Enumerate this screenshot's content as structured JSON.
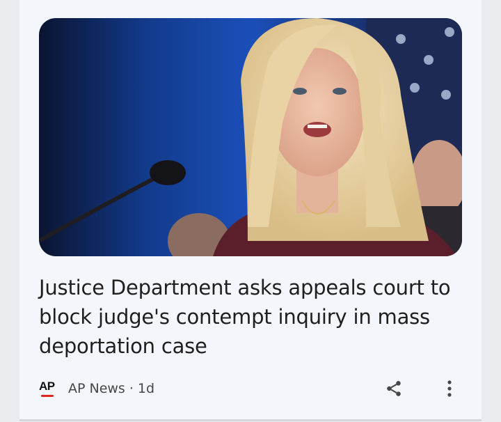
{
  "article": {
    "image_alt": "Photo of a blonde woman speaking at a microphone in front of a flag",
    "headline": "Justice Department asks appeals court to block judge's contempt inquiry in mass deportation case",
    "source": {
      "logo_text": "AP",
      "name": "AP News",
      "separator": "·",
      "age": "1d"
    },
    "actions": {
      "share_icon": "share-icon",
      "more_icon": "more-vert-icon"
    }
  }
}
